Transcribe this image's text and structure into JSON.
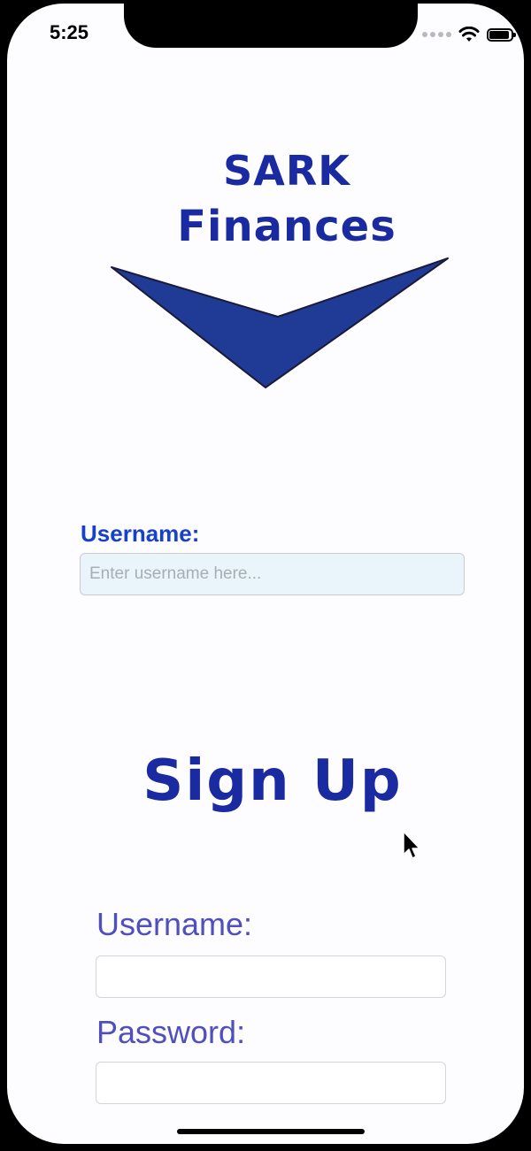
{
  "status_bar": {
    "time": "5:25",
    "icons": [
      "signal-dots-icon",
      "wifi-icon",
      "battery-icon"
    ]
  },
  "logo": {
    "line1": "SARK",
    "line2": "Finances",
    "color": "#1a2aa0"
  },
  "login": {
    "username_label": "Username:",
    "username_placeholder": "Enter username here...",
    "username_value": ""
  },
  "signup": {
    "title": "Sign Up",
    "username_label": "Username:",
    "username_value": "",
    "password_label": "Password:",
    "password_value": ""
  },
  "colors": {
    "accent": "#1641c8",
    "brand": "#1a2aa0",
    "label_secondary": "#4f4fbd",
    "input_bg": "#e9f4fb"
  }
}
